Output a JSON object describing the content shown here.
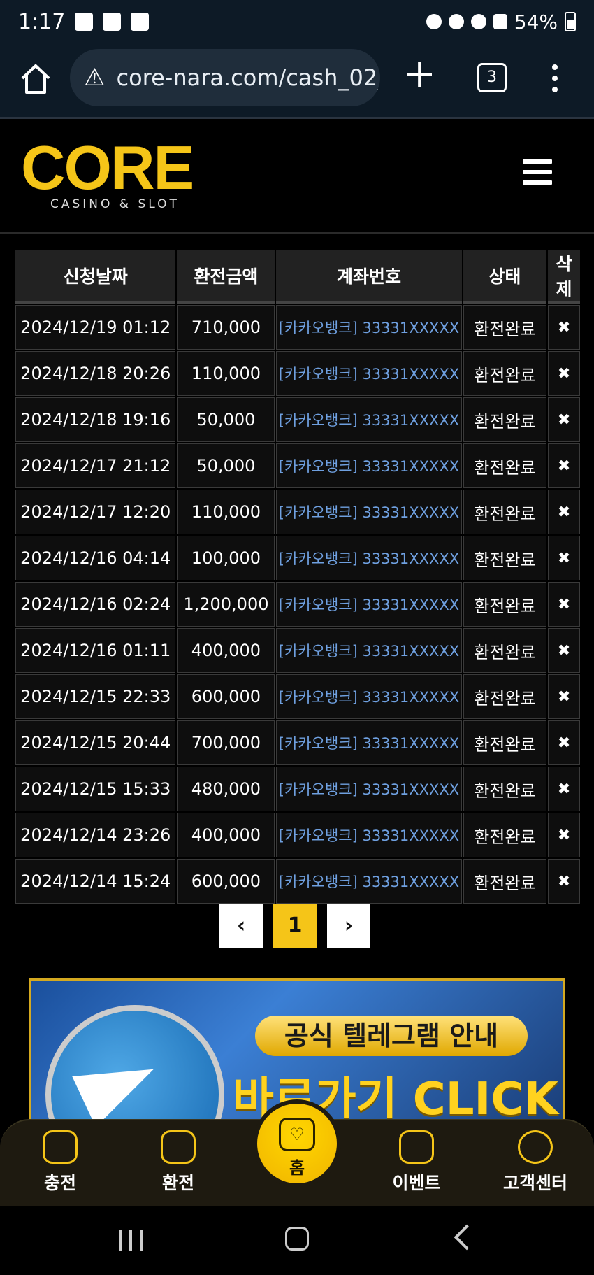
{
  "status_bar": {
    "time": "1:17",
    "battery": "54%"
  },
  "browser": {
    "url": "core-nara.com/cash_02_",
    "tab_count": "3"
  },
  "site": {
    "logo_word": "CORE",
    "logo_sub": "CASINO & SLOT"
  },
  "table": {
    "headers": [
      "신청날짜",
      "환전금액",
      "계좌번호",
      "상태",
      "삭제"
    ],
    "rows": [
      {
        "date": "2024/12/19 01:12",
        "amount": "710,000",
        "account": "[카카오뱅크] 33331XXXXX",
        "status": "환전완료"
      },
      {
        "date": "2024/12/18 20:26",
        "amount": "110,000",
        "account": "[카카오뱅크] 33331XXXXX",
        "status": "환전완료"
      },
      {
        "date": "2024/12/18 19:16",
        "amount": "50,000",
        "account": "[카카오뱅크] 33331XXXXX",
        "status": "환전완료"
      },
      {
        "date": "2024/12/17 21:12",
        "amount": "50,000",
        "account": "[카카오뱅크] 33331XXXXX",
        "status": "환전완료"
      },
      {
        "date": "2024/12/17 12:20",
        "amount": "110,000",
        "account": "[카카오뱅크] 33331XXXXX",
        "status": "환전완료"
      },
      {
        "date": "2024/12/16 04:14",
        "amount": "100,000",
        "account": "[카카오뱅크] 33331XXXXX",
        "status": "환전완료"
      },
      {
        "date": "2024/12/16 02:24",
        "amount": "1,200,000",
        "account": "[카카오뱅크] 33331XXXXX",
        "status": "환전완료"
      },
      {
        "date": "2024/12/16 01:11",
        "amount": "400,000",
        "account": "[카카오뱅크] 33331XXXXX",
        "status": "환전완료"
      },
      {
        "date": "2024/12/15 22:33",
        "amount": "600,000",
        "account": "[카카오뱅크] 33331XXXXX",
        "status": "환전완료"
      },
      {
        "date": "2024/12/15 20:44",
        "amount": "700,000",
        "account": "[카카오뱅크] 33331XXXXX",
        "status": "환전완료"
      },
      {
        "date": "2024/12/15 15:33",
        "amount": "480,000",
        "account": "[카카오뱅크] 33331XXXXX",
        "status": "환전완료"
      },
      {
        "date": "2024/12/14 23:26",
        "amount": "400,000",
        "account": "[카카오뱅크] 33331XXXXX",
        "status": "환전완료"
      },
      {
        "date": "2024/12/14 15:24",
        "amount": "600,000",
        "account": "[카카오뱅크] 33331XXXXX",
        "status": "환전완료"
      }
    ],
    "delete_glyph": "✖"
  },
  "pagination": {
    "prev": "‹",
    "current": "1",
    "next": "›"
  },
  "banner": {
    "line1": "공식 텔레그램 안내",
    "line2": "바로가기 CLICK"
  },
  "bottom_nav": {
    "charge": "충전",
    "exchange": "환전",
    "home": "홈",
    "event": "이벤트",
    "support": "고객센터"
  },
  "colors": {
    "accent": "#f5c518",
    "account_link": "#6fa0e0",
    "background": "#000000"
  }
}
